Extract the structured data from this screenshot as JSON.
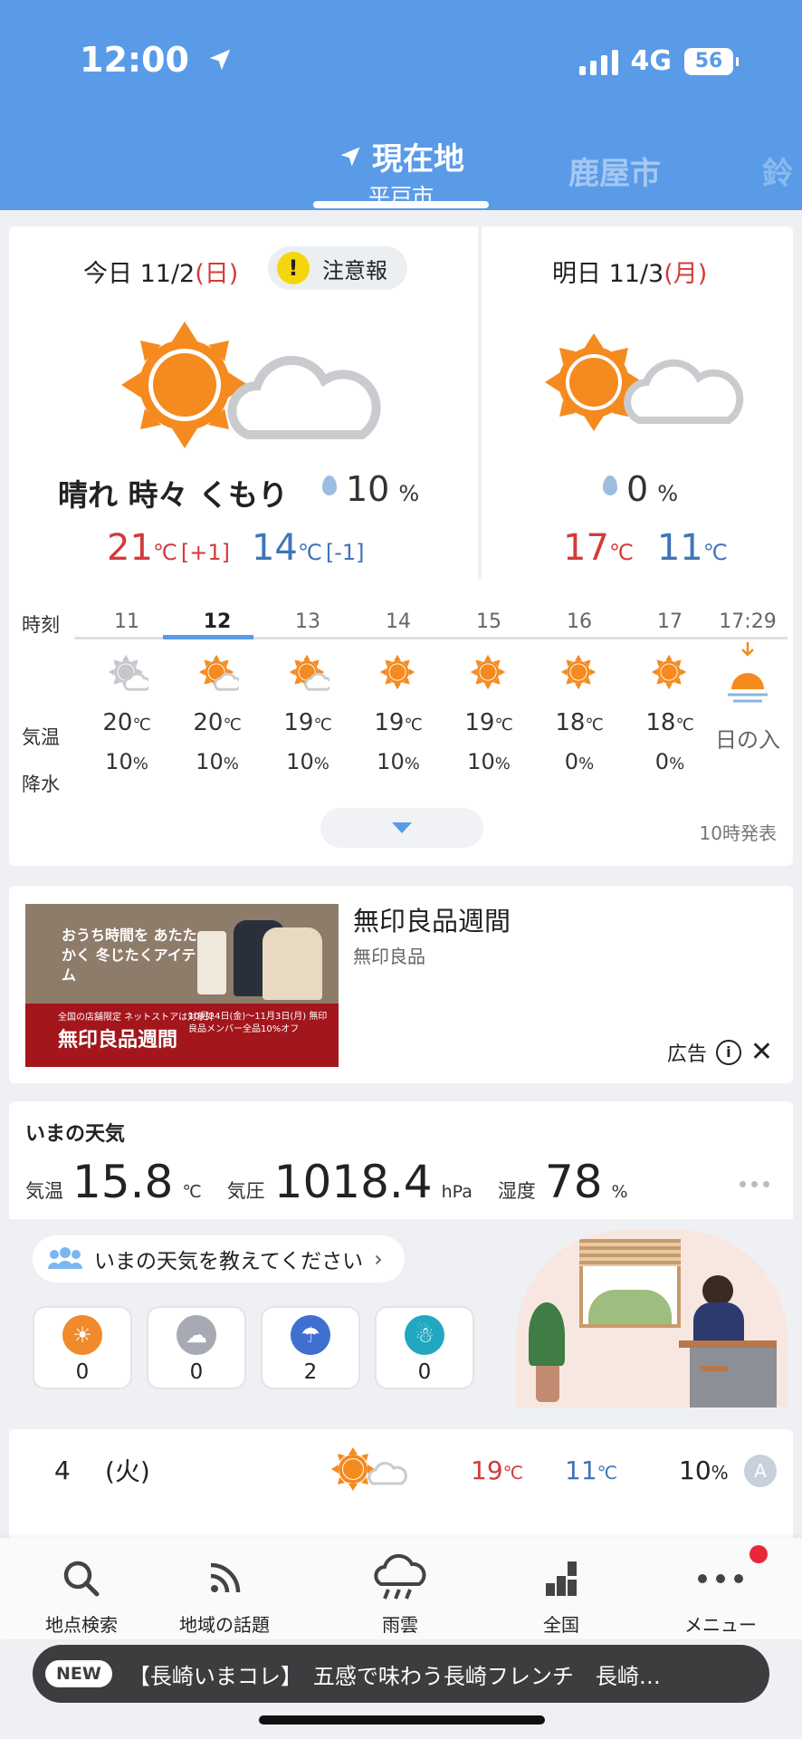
{
  "status": {
    "time": "12:00",
    "network": "4G",
    "battery": "56"
  },
  "locations": {
    "current": {
      "label": "現在地",
      "sub": "平戸市"
    },
    "tab2": "鹿屋市",
    "tab3": "鈴"
  },
  "today": {
    "prefix": "今日",
    "date": "11/2",
    "weekday": "(日)",
    "alert": "注意報",
    "alert_icon": "!",
    "weather": "晴れ 時々 くもり",
    "rain": "10",
    "rain_unit": "%",
    "high": "21",
    "high_diff": "[+1]",
    "low": "14",
    "low_diff": "[-1]",
    "unit": "℃"
  },
  "tomorrow": {
    "prefix": "明日",
    "date": "11/3",
    "weekday": "(月)",
    "rain": "0",
    "rain_unit": "%",
    "high": "17",
    "low": "11",
    "unit": "℃"
  },
  "hourly": {
    "labels": {
      "time": "時刻",
      "temp": "気温",
      "precip": "降水"
    },
    "unit": "℃",
    "pct": "%",
    "hours": [
      {
        "h": "11",
        "t": "20",
        "p": "10",
        "icon": "sun-cloud-gray-icon"
      },
      {
        "h": "12",
        "t": "20",
        "p": "10",
        "icon": "sun-cloud-icon"
      },
      {
        "h": "13",
        "t": "19",
        "p": "10",
        "icon": "sun-cloud-icon"
      },
      {
        "h": "14",
        "t": "19",
        "p": "10",
        "icon": "sun-icon"
      },
      {
        "h": "15",
        "t": "19",
        "p": "10",
        "icon": "sun-icon"
      },
      {
        "h": "16",
        "t": "18",
        "p": "0",
        "icon": "sun-icon"
      },
      {
        "h": "17",
        "t": "18",
        "p": "0",
        "icon": "sun-icon"
      }
    ],
    "sunset": {
      "h": "17:29",
      "label": "日の入"
    },
    "issued": "10時発表"
  },
  "ad": {
    "title": "無印良品週間",
    "sponsor": "無印良品",
    "label": "広告",
    "image_copy": "おうち時間を あたたかく 冬じたくアイテム",
    "image_week": "無印良品週間",
    "image_note": "全国の店舗限定 ネットストアは対象外",
    "image_detail": "10月24日(金)～11月3日(月) 無印良品メンバー全品10%オフ"
  },
  "current": {
    "title": "いまの天気",
    "temp_label": "気温",
    "temp": "15.8",
    "temp_unit": "℃",
    "pressure_label": "気圧",
    "pressure": "1018.4",
    "pressure_unit": "hPa",
    "humidity_label": "湿度",
    "humidity": "78",
    "humidity_unit": "%",
    "report_prompt": "いまの天気を教えてください",
    "reports": [
      {
        "type": "sunny",
        "count": "0",
        "color": "#f08a2c"
      },
      {
        "type": "cloudy",
        "count": "0",
        "color": "#a7aab3"
      },
      {
        "type": "rain",
        "count": "2",
        "color": "#3f6fd1"
      },
      {
        "type": "snow",
        "count": "0",
        "color": "#22a7c0"
      }
    ]
  },
  "daily": [
    {
      "day": "4",
      "weekday": "(火)",
      "high": "19",
      "low": "11",
      "rain": "10",
      "badge": "A"
    }
  ],
  "nav": [
    {
      "label": "地点検索",
      "icon": "search-icon"
    },
    {
      "label": "地域の話題",
      "icon": "rss-icon"
    },
    {
      "label": "雨雲",
      "icon": "rain-cloud-icon"
    },
    {
      "label": "全国",
      "icon": "bars-icon"
    },
    {
      "label": "メニュー",
      "icon": "more-icon"
    }
  ],
  "ticker": {
    "badge": "NEW",
    "text": "【長崎いまコレ】　五感で味わう長崎フレンチ　長崎…"
  },
  "colors": {
    "header": "#5a9be8",
    "high": "#d33b3b",
    "low": "#3f74b8",
    "sun": "#f58a1f"
  }
}
